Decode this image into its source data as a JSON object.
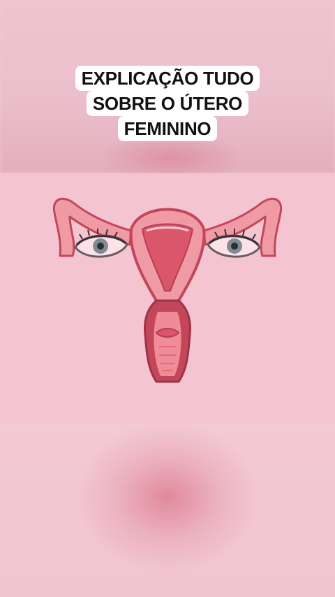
{
  "caption": {
    "lines": [
      "EXPLICAÇÃO TUDO",
      "SOBRE O ÚTERO",
      "FEMININO"
    ]
  },
  "illustration": {
    "subject": "uterus-with-eyes-cartoon",
    "colors": {
      "background": "#f4c5d1",
      "outline": "#c2475a",
      "tissue": "#ef9aa5",
      "cavity": "#d9566b",
      "inner": "#f5b3bd",
      "eye_iris": "#7d8b93"
    }
  },
  "colors": {
    "caption_background": "#ffffff",
    "caption_text": "#111111",
    "page_background": "#f2c6d3"
  }
}
